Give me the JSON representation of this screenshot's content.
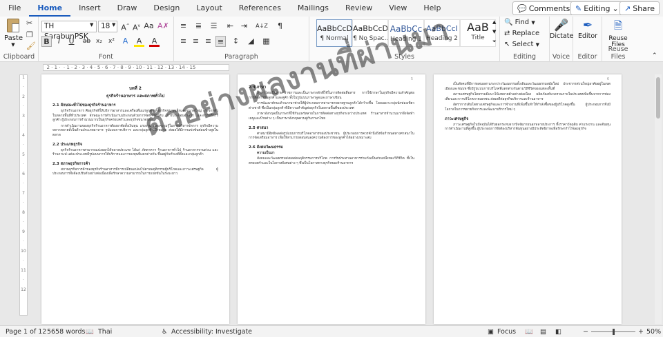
{
  "tabs": [
    "File",
    "Home",
    "Insert",
    "Draw",
    "Design",
    "Layout",
    "References",
    "Mailings",
    "Review",
    "View",
    "Help"
  ],
  "active_tab": "Home",
  "top_right": {
    "comments": "Comments",
    "editing": "Editing",
    "share": "Share"
  },
  "clipboard": {
    "paste": "Paste",
    "label": "Clipboard"
  },
  "font": {
    "name": "TH SarabunPSK",
    "size": "18",
    "label": "Font",
    "buttons": [
      "B",
      "I",
      "U",
      "ab",
      "x₂",
      "x²",
      "A",
      "A",
      "A"
    ]
  },
  "paragraph": {
    "label": "Paragraph",
    "sort_icon": "A↓Z",
    "pilcrow": "¶"
  },
  "styles": {
    "label": "Styles",
    "items": [
      {
        "sample": "AaBbCcDc",
        "name": "¶ Normal"
      },
      {
        "sample": "AaBbCcDc",
        "name": "¶ No Spac..."
      },
      {
        "sample": "AaBbCc",
        "name": "Heading 1"
      },
      {
        "sample": "AaBbCcI",
        "name": "Heading 2"
      },
      {
        "sample": "AaB",
        "name": "Title"
      }
    ]
  },
  "editing_group": {
    "find": "Find",
    "replace": "Replace",
    "select": "Select",
    "label": "Editing"
  },
  "voice": {
    "dictate": "Dictate",
    "label": "Voice"
  },
  "editor": {
    "name": "Editor",
    "label": "Editor"
  },
  "reuse": {
    "name": "Reuse Files",
    "label": "Reuse Files"
  },
  "pages": [
    {
      "number": "",
      "title": "บทที่ 2",
      "subtitle": "ธุรกิจร้านอาหาร และสภาพทั่วไป",
      "sections": [
        {
          "h": "2.1 ลักษณะทั่วไปของธุรกิจร้านอาหาร",
          "p": [
            "ธุรกิจร้านอาหาร คือธุรกิจที่ให้บริการอาหารและเครื่องดื่มแก่ลูกค้า ทั้งธุรกิจขนาดเล็กและขนาดใหญ่ กระจายตัวในหลายพื้นที่ทั่วประเทศ ลักษณะการดำเนินงานประกอบด้วยการจัดหาวัตถุดิบ การประกอบอาหาร และการบริการลูกค้า ผู้ประกอบการจำนวนมากเป็นธุรกิจครอบครัวและธุรกิจขนาดย่อม",
            "การดำเนินงานของธุรกิจร้านอาหารต้องอาศัยทั้งเงินทุน แรงงาน และความรู้ในการบริหารจัดการ ธุรกิจมีความหลากหลายทั้งในด้านประเภทอาหาร รูปแบบการบริการ และกลุ่มลูกค้าเป้าหมาย ส่งผลให้มีการแข่งขันค่อนข้างสูงในตลาด"
          ]
        },
        {
          "h": "2.2 ประเภทธุรกิจ",
          "p": [
            "ธุรกิจร้านอาหารสามารถแบ่งออกได้หลายประเภท ได้แก่ ภัตตาคาร ร้านอาหารทั่วไป ร้านอาหารจานด่วน และร้านกาแฟ แต่ละประเภทมีรูปแบบการให้บริการและการลงทุนที่แตกต่างกัน ขึ้นอยู่กับทำเลที่ตั้งและกลุ่มลูกค้า"
          ]
        },
        {
          "h": "2.3 สภาพธุรกิจการค้า",
          "p": [
            "สภาพธุรกิจการค้าของธุรกิจร้านอาหารมีการเปลี่ยนแปลงไปตามพฤติกรรมผู้บริโภคและภาวะเศรษฐกิจ ผู้ประกอบการจึงต้องปรับตัวอย่างต่อเนื่องเพื่อรักษาความสามารถในการแข่งขันในระยะยาว"
          ]
        }
      ]
    },
    {
      "number": "5",
      "sections": [
        {
          "h": "2.4 ภาษา",
          "p": [
            "ภาษาไทยเป็นภาษาราชการและเป็นภาษาหลักที่ใช้ในการติดต่อสื่อสาร การใช้ภาษาในธุรกิจมีความสำคัญต่อการสื่อสารกับลูกค้าและคู่ค้า ทั้งในรูปแบบภาษาพูดและภาษาเขียน",
            "การพัฒนาทักษะด้านภาษาช่วยให้ผู้ประกอบการสามารถขยายฐานลูกค้าได้กว้างขึ้น โดยเฉพาะกลุ่มนักท่องเที่ยวต่างชาติ ซึ่งเป็นกลุ่มลูกค้าที่มีความสำคัญต่อธุรกิจในหลายพื้นที่ของประเทศ",
            "ภาษาอังกฤษเป็นภาษาที่ใช้กันแพร่หลายในการติดต่อทางธุรกิจระหว่างประเทศ ร้านอาหารจำนวนมากจึงจัดทำเมนูและป้ายต่าง ๆ เป็นภาษาอังกฤษควบคู่กับภาษาไทย"
          ]
        },
        {
          "h": "2.5 ศาสนา",
          "p": [
            "ศาสนามีอิทธิพลต่อรูปแบบการบริโภคอาหารของประชาชน ผู้ประกอบการควรคำนึงถึงข้อกำหนดทางศาสนาในการจัดเตรียมอาหาร เพื่อให้สามารถตอบสนองความต้องการของลูกค้าได้อย่างเหมาะสม"
          ]
        },
        {
          "h": "2.6 สังคมวัฒนธรรม",
          "p": [
            "ความเป็นมา",
            "สังคมและวัฒนธรรมส่งผลต่อพฤติกรรมการบริโภค การรับประทานอาหารร่วมกันเป็นส่วนหนึ่งของวิถีชีวิต ทั้งในครอบครัวและในโอกาสพิเศษต่าง ๆ ซึ่งเป็นโอกาสทางธุรกิจของร้านอาหาร"
          ]
        }
      ]
    },
    {
      "number": "6",
      "sections": [
        {
          "h": "",
          "p": [
            "เป็นสังคมที่มีการผสมผสานระหว่างวัฒนธรรมดั้งเดิมและวัฒนธรรมสมัยใหม่ ประชากรส่วนใหญ่อาศัยอยู่ในเขตเมืองและชนบท ซึ่งมีรูปแบบการบริโภคที่แตกต่างกันตามวิถีชีวิตของแต่ละพื้นที่",
            "สภาพเศรษฐกิจโดยรวมมีแนวโน้มขยายตัวอย่างต่อเนื่อง ผลิตภัณฑ์มวลรวมภายในประเทศเพิ่มขึ้นจากการท่องเที่ยวและการบริโภคภาคเอกชน ส่งผลดีต่อธุรกิจบริการและร้านอาหาร",
            "อัตราการเติบโตทางเศรษฐกิจและการจ้างงานที่เพิ่มขึ้นทำให้กำลังซื้อของผู้บริโภคสูงขึ้น ผู้ประกอบการจึงมีโอกาสในการขยายกิจการและพัฒนาบริการใหม่ ๆ"
          ]
        },
        {
          "h": "ภาวะเศรษฐกิจ",
          "p": [
            "ภาวะเศรษฐกิจในปัจจุบันได้รับผลกระทบจากปัจจัยภายนอกหลายประการ ทั้งราคาวัตถุดิบ ค่าแรงงาน และต้นทุนการดำเนินงานที่สูงขึ้น ผู้ประกอบการจึงต้องบริหารต้นทุนอย่างมีประสิทธิภาพเพื่อรักษากำไรของธุรกิจ"
          ]
        }
      ]
    }
  ],
  "watermark": "ตัวอย่างผลงานที่ผ่านมา",
  "status": {
    "page": "Page 1 of 12",
    "words": "5658 words",
    "language": "Thai",
    "accessibility": "Accessibility: Investigate",
    "focus": "Focus",
    "zoom": "50%",
    "zoom_fraction": 0.5
  }
}
